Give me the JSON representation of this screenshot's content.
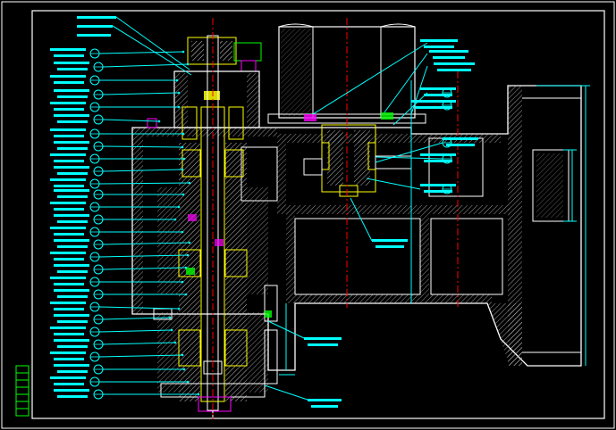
{
  "drawing": {
    "colors": {
      "background": "#000000",
      "frame": "#ffffff",
      "part_outline": "#ffff00",
      "leader": "#00ffff",
      "hatch": "#d6d6d6",
      "centerline": "#ff0000",
      "dimension": "#00ffff",
      "detail": "#00ff00",
      "accent": "#ff00ff"
    },
    "label_text_visible": false,
    "left_balloon_count": 30,
    "right_balloon_count": 8
  }
}
